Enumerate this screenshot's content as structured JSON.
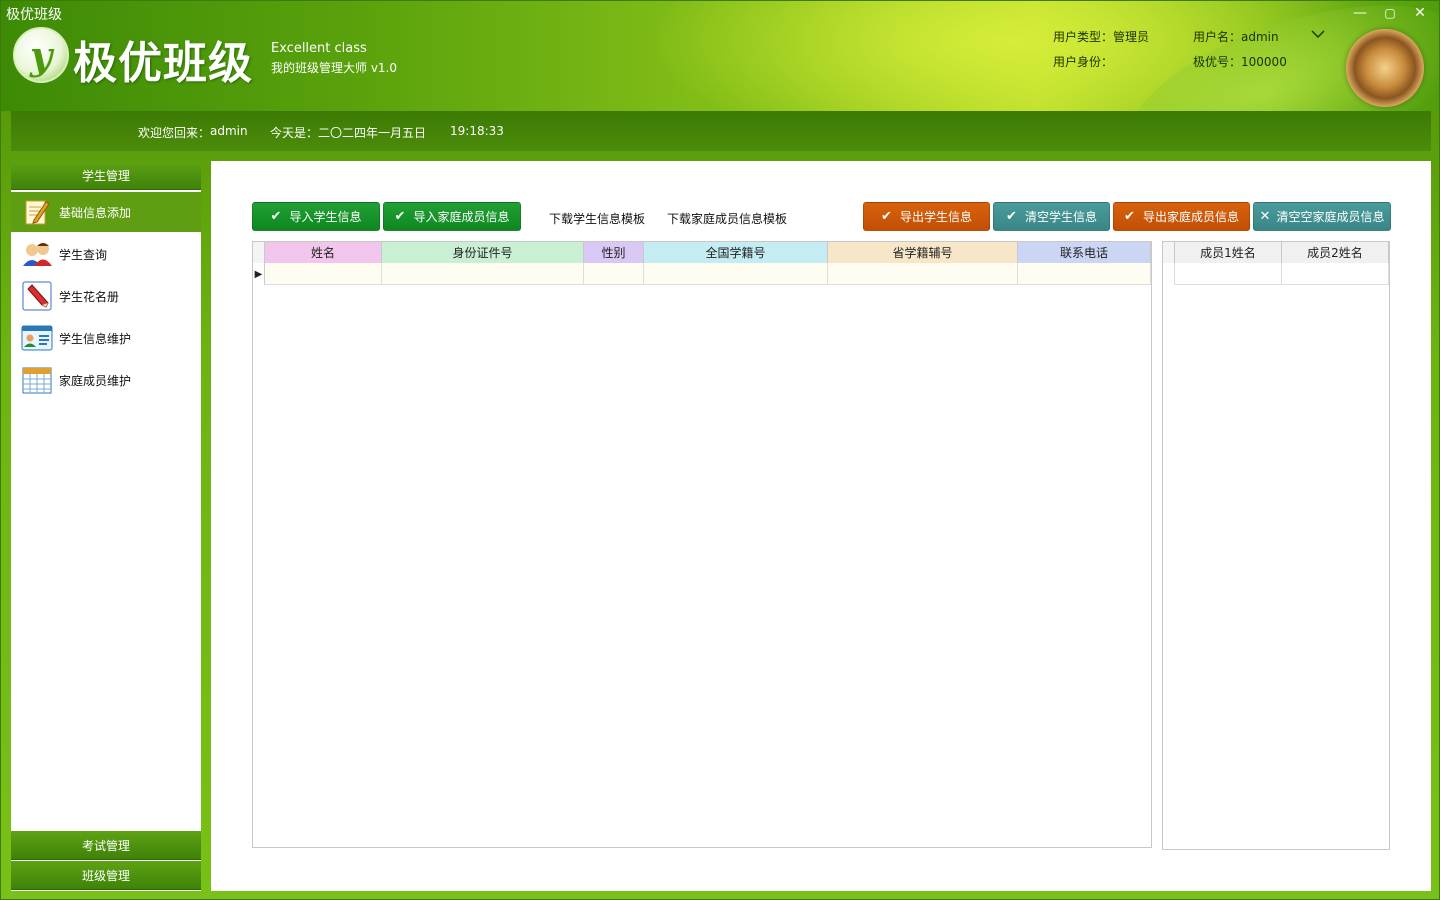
{
  "window": {
    "title": "极优班级",
    "controls": {
      "minimize": "—",
      "maximize": "▢",
      "close": "✕"
    }
  },
  "header": {
    "logo_letter": "y",
    "brand_name": "极优班级",
    "brand_en": "Excellent class",
    "subtitle": "我的班级管理大师  v1.0",
    "user_type_label": "用户类型：",
    "user_type_value": "管理员",
    "username_label": "用户名：",
    "username_value": "admin",
    "identity_label": "用户身份：",
    "identity_value": "",
    "jiyou_no_label": "极优号：",
    "jiyou_no_value": "100000"
  },
  "welcome": {
    "greeting_label": "欢迎您回来：",
    "greeting_user": "admin",
    "date_label": "今天是：",
    "date_value": "二〇二四年一月五日",
    "time": "19:18:33"
  },
  "sidebar": {
    "section_student": "学生管理",
    "items": [
      {
        "label": "基础信息添加",
        "icon": "edit-note-icon",
        "active": true
      },
      {
        "label": "学生查询",
        "icon": "users-icon",
        "active": false
      },
      {
        "label": "学生花名册",
        "icon": "pencil-icon",
        "active": false
      },
      {
        "label": "学生信息维护",
        "icon": "id-card-icon",
        "active": false
      },
      {
        "label": "家庭成员维护",
        "icon": "calendar-grid-icon",
        "active": false
      }
    ],
    "section_exam": "考试管理",
    "section_class": "班级管理"
  },
  "toolbar": {
    "import_student": "导入学生信息",
    "import_family": "导入家庭成员信息",
    "download_student_template": "下载学生信息模板",
    "download_family_template": "下载家庭成员信息模板",
    "export_student": "导出学生信息",
    "clear_student": "清空学生信息",
    "export_family": "导出家庭成员信息",
    "clear_family": "清空空家庭成员信息"
  },
  "student_grid": {
    "columns": [
      {
        "label": "姓名",
        "color": "#f2c6ec"
      },
      {
        "label": "身份证件号",
        "color": "#c9f0d3"
      },
      {
        "label": "性别",
        "color": "#d9c8f5"
      },
      {
        "label": "全国学籍号",
        "color": "#c4ecf3"
      },
      {
        "label": "省学籍辅号",
        "color": "#f7e6c8"
      },
      {
        "label": "联系电话",
        "color": "#cbd6f5"
      }
    ]
  },
  "family_grid": {
    "columns": [
      {
        "label": "成员1姓名",
        "color": "#f0f0f0"
      },
      {
        "label": "成员2姓名",
        "color": "#f0f0f0"
      }
    ]
  },
  "colors": {
    "brand_green": "#5da312",
    "button_green": "#0f8722",
    "button_orange": "#c14f06",
    "button_teal": "#3a8686"
  }
}
